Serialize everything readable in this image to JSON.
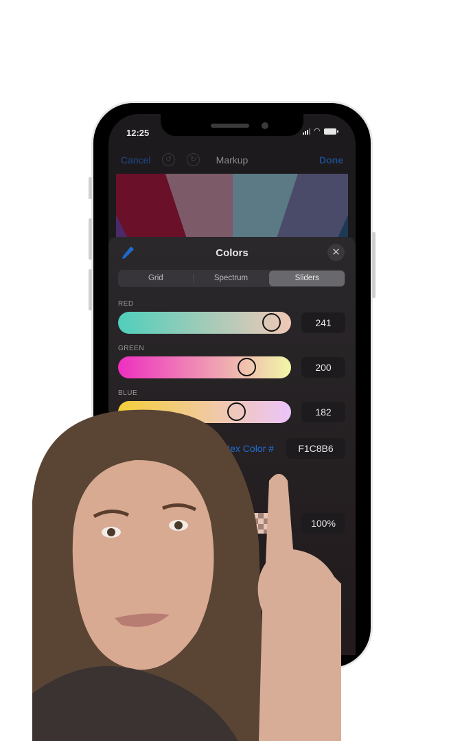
{
  "status_bar": {
    "time": "12:25"
  },
  "navbar": {
    "cancel_label": "Cancel",
    "title": "Markup",
    "done_label": "Done",
    "undo_icon": "undo-icon",
    "redo_icon": "redo-icon"
  },
  "canvas": {
    "colors": [
      "#6a1029",
      "#7d5a68",
      "#5c7a85",
      "#4a4b68"
    ]
  },
  "color_picker": {
    "title": "Colors",
    "eyedropper_icon": "eyedropper-icon",
    "close_icon": "close-icon",
    "tabs": [
      {
        "label": "Grid",
        "active": false
      },
      {
        "label": "Spectrum",
        "active": false
      },
      {
        "label": "Sliders",
        "active": true
      }
    ],
    "sliders": [
      {
        "label": "RED",
        "value": "241",
        "fraction": 0.945,
        "gradient": [
          "#4fcfbb",
          "#f1c8b6"
        ]
      },
      {
        "label": "GREEN",
        "value": "200",
        "fraction": 0.784,
        "gradient": [
          "#ee2fc0",
          "#f1f7a8"
        ]
      },
      {
        "label": "BLUE",
        "value": "182",
        "fraction": 0.714,
        "gradient": [
          "#f5cf3a",
          "#ecc4fb"
        ]
      }
    ],
    "hex_label": "P3 Hex Color #",
    "hex_value": "F1C8B6",
    "opacity_value": "100%",
    "swatches": [
      "#4ccf5f",
      "#f4cc30"
    ],
    "accent": "#1e6fd6"
  },
  "presenter": {
    "description": "video-overlay-person-pointing"
  }
}
